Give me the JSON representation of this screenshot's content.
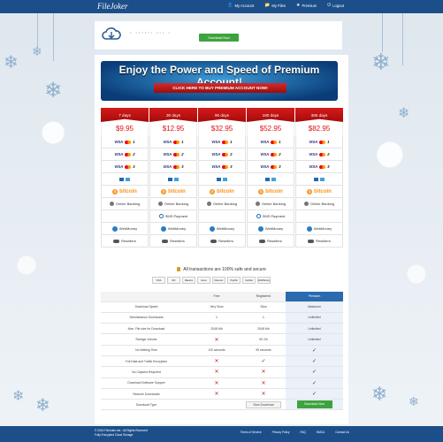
{
  "brand": {
    "logo_text": "FileJoker"
  },
  "nav": {
    "items": [
      {
        "label": "My Account",
        "icon": "user-icon"
      },
      {
        "label": "My Files",
        "icon": "folder-icon"
      },
      {
        "label": "Premium",
        "icon": "star-icon"
      },
      {
        "label": "Logout",
        "icon": "power-icon"
      }
    ]
  },
  "upload": {
    "filename": "•  ••••••  •••  •",
    "download_label": "Download Now"
  },
  "banner": {
    "title": "Enjoy the Power and Speed of Premium Account!",
    "cta": "CLICK HERE TO BUY PREMIUM ACCOUNT NOW!"
  },
  "plans": [
    {
      "duration": "7 days",
      "price": "$9.95"
    },
    {
      "duration": "30 days",
      "price": "$12.95"
    },
    {
      "duration": "90 days",
      "price": "$32.95"
    },
    {
      "duration": "180 days",
      "price": "$52.95"
    },
    {
      "duration": "365 days",
      "price": "$82.95"
    }
  ],
  "payment": {
    "visa_label": "VISA",
    "card_numbers": [
      "1",
      "2",
      "3"
    ],
    "bitcoin_label": "bitcoin",
    "online_banking": "Online Banking",
    "sms_payment": "SMS Payment",
    "webmoney": "WebMoney",
    "resellers": "Resellers"
  },
  "secure": {
    "text": "All transactions are 100% safe and secure",
    "logos": [
      "VISA",
      "MC",
      "Maestro",
      "Amex",
      "Discover",
      "PayPal",
      "Verified",
      "WebMoney"
    ]
  },
  "comparison": {
    "headers": [
      "",
      "Free",
      "Registered",
      "Premium"
    ],
    "rows": [
      {
        "feature": "Download Speed",
        "free": "Very Slow",
        "registered": "Slow",
        "premium": "Maximum"
      },
      {
        "feature": "Simultaneous Downloads",
        "free": "1",
        "registered": "1",
        "premium": "Unlimited"
      },
      {
        "feature": "Max. File size for Download",
        "free": "2048 Mb",
        "registered": "2048 Mb",
        "premium": "Unlimited"
      },
      {
        "feature": "Storage Volume",
        "free": "x",
        "registered": "50 Gb",
        "premium": "Unlimited"
      },
      {
        "feature": "No Waiting Time",
        "free": "120 seconds",
        "registered": "90 seconds",
        "premium": "check"
      },
      {
        "feature": "Full Data and Traffic Encryption",
        "free": "x",
        "registered": "check",
        "premium": "check"
      },
      {
        "feature": "No Captcha Required",
        "free": "x",
        "registered": "x",
        "premium": "check"
      },
      {
        "feature": "Download Software Support",
        "free": "x",
        "registered": "x",
        "premium": "check"
      },
      {
        "feature": "Resume Downloads",
        "free": "x",
        "registered": "x",
        "premium": "check"
      },
      {
        "feature": "Download Type",
        "free": "",
        "registered": "Slow Download",
        "premium": "Download Now"
      }
    ]
  },
  "footer": {
    "copyright": "© 2016 FileJoker.net - All Rights Reserved",
    "sub": "Fully Encrypted Cloud Storage",
    "links": [
      "Terms of Service",
      "Privacy Policy",
      "FAQ",
      "DMCA",
      "Contact Us"
    ]
  },
  "colors": {
    "nav_bg": "#1c4f8a",
    "accent_red": "#c41010",
    "accent_green": "#3ea33e"
  }
}
